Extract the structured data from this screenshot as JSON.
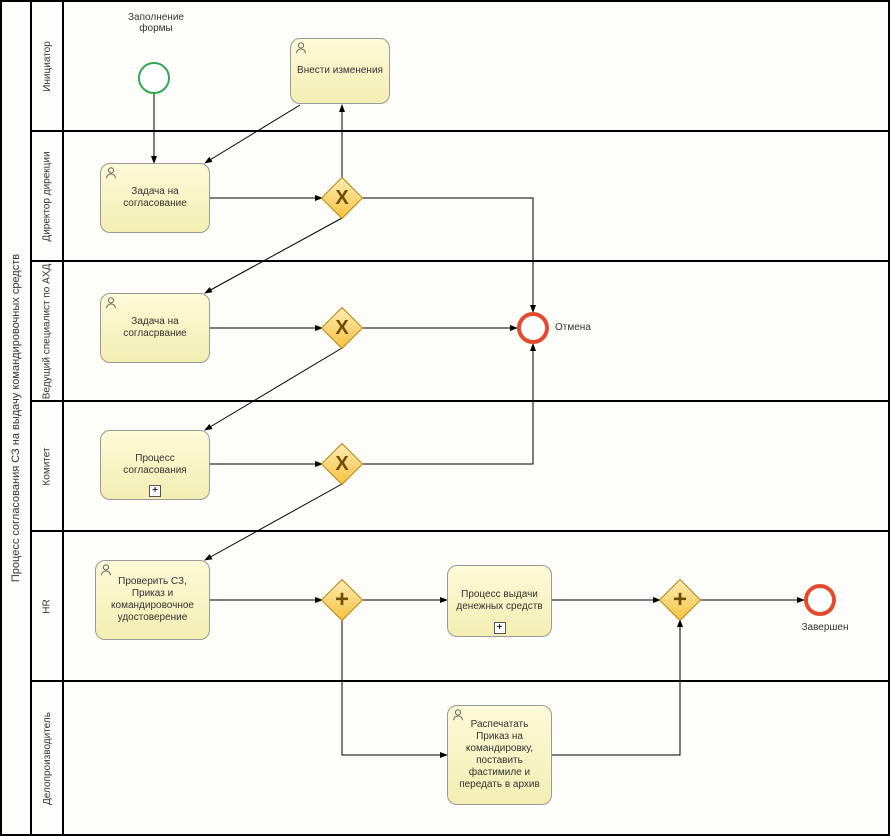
{
  "pool": {
    "title": "Процесс согласования СЗ на выдачу командировочных средств"
  },
  "lanes": {
    "l1": "Инициатор",
    "l2": "Директор дирекции",
    "l3": "Ведущий специалист по АХД",
    "l4": "Комитет",
    "l5": "HR",
    "l6": "Делопроизводитель"
  },
  "events": {
    "start_label": "Заполнение формы",
    "cancel_label": "Отмена",
    "end_label": "Завершен"
  },
  "tasks": {
    "t_change": "Внести изменения",
    "t_task1": "Задача на согласование",
    "t_task2": "Задача на согласрвание",
    "t_proc_approve": "Процесс согласования",
    "t_check": "Проверить СЗ, Приказ и командировочное удостоверение",
    "t_money": "Процесс выдачи денежных средств",
    "t_print": "Распечатать Приказ на командировку, поставить фастимиле и передать в архив"
  },
  "gateways": {
    "g1": "X",
    "g2": "X",
    "g3": "X",
    "g_par1": "+",
    "g_par2": "+"
  },
  "chart_data": {
    "type": "bpmn",
    "pool": "Процесс согласования СЗ на выдачу командировочных средств",
    "lanes": [
      "Инициатор",
      "Директор дирекции",
      "Ведущий специалист по АХД",
      "Комитет",
      "HR",
      "Делопроизводитель"
    ],
    "nodes": [
      {
        "id": "start",
        "type": "startEvent",
        "lane": "Инициатор",
        "label": "Заполнение формы"
      },
      {
        "id": "t_change",
        "type": "userTask",
        "lane": "Инициатор",
        "label": "Внести изменения"
      },
      {
        "id": "t_task1",
        "type": "userTask",
        "lane": "Директор дирекции",
        "label": "Задача на согласование"
      },
      {
        "id": "g1",
        "type": "exclusiveGateway",
        "lane": "Директор дирекции"
      },
      {
        "id": "t_task2",
        "type": "userTask",
        "lane": "Ведущий специалист по АХД",
        "label": "Задача на согласрвание"
      },
      {
        "id": "g2",
        "type": "exclusiveGateway",
        "lane": "Ведущий специалист по АХД"
      },
      {
        "id": "cancel",
        "type": "endEvent",
        "lane": "Ведущий специалист по АХД",
        "label": "Отмена"
      },
      {
        "id": "t_proc_approve",
        "type": "subProcess",
        "lane": "Комитет",
        "label": "Процесс согласования"
      },
      {
        "id": "g3",
        "type": "exclusiveGateway",
        "lane": "Комитет"
      },
      {
        "id": "t_check",
        "type": "userTask",
        "lane": "HR",
        "label": "Проверить СЗ, Приказ и командировочное удостоверение"
      },
      {
        "id": "g_par1",
        "type": "parallelGateway",
        "lane": "HR"
      },
      {
        "id": "t_money",
        "type": "subProcess",
        "lane": "HR",
        "label": "Процесс выдачи денежных средств"
      },
      {
        "id": "g_par2",
        "type": "parallelGateway",
        "lane": "HR"
      },
      {
        "id": "end",
        "type": "endEvent",
        "lane": "HR",
        "label": "Завершен"
      },
      {
        "id": "t_print",
        "type": "userTask",
        "lane": "Делопроизводитель",
        "label": "Распечатать Приказ на командировку, поставить фастимиле и передать в архив"
      }
    ],
    "flows": [
      {
        "from": "start",
        "to": "t_task1"
      },
      {
        "from": "t_task1",
        "to": "g1"
      },
      {
        "from": "g1",
        "to": "t_change"
      },
      {
        "from": "t_change",
        "to": "t_task1"
      },
      {
        "from": "g1",
        "to": "cancel"
      },
      {
        "from": "g1",
        "to": "t_task2"
      },
      {
        "from": "t_task2",
        "to": "g2"
      },
      {
        "from": "g2",
        "to": "cancel"
      },
      {
        "from": "g2",
        "to": "t_proc_approve"
      },
      {
        "from": "t_proc_approve",
        "to": "g3"
      },
      {
        "from": "g3",
        "to": "cancel"
      },
      {
        "from": "g3",
        "to": "t_check"
      },
      {
        "from": "t_check",
        "to": "g_par1"
      },
      {
        "from": "g_par1",
        "to": "t_money"
      },
      {
        "from": "g_par1",
        "to": "t_print"
      },
      {
        "from": "t_money",
        "to": "g_par2"
      },
      {
        "from": "t_print",
        "to": "g_par2"
      },
      {
        "from": "g_par2",
        "to": "end"
      }
    ]
  }
}
